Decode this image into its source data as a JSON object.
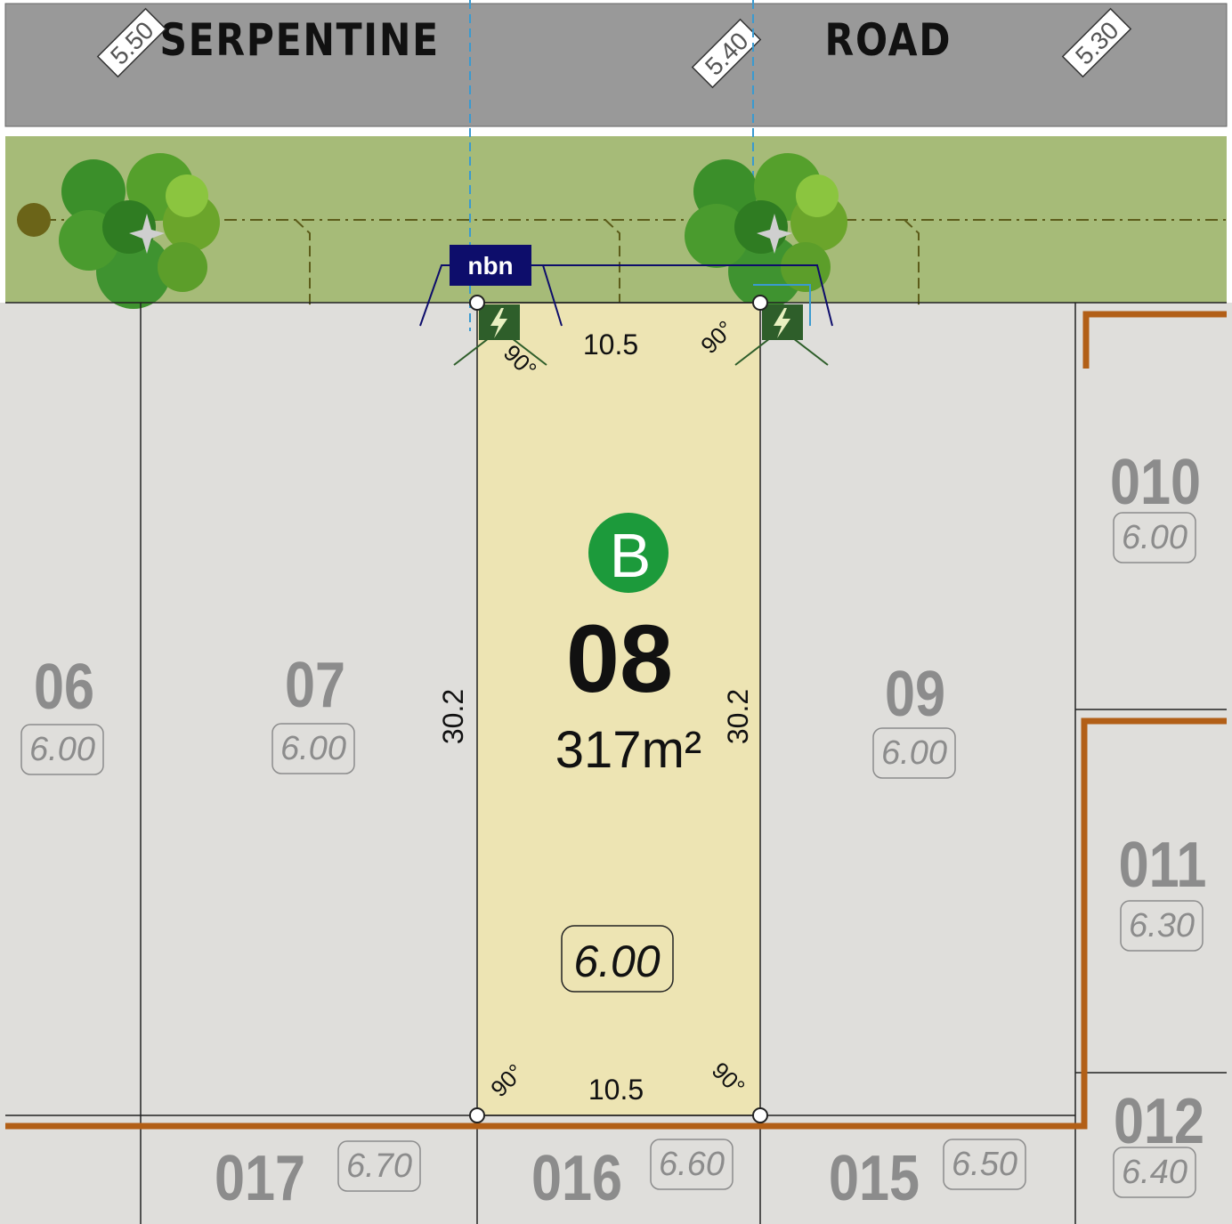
{
  "road": {
    "name_left": "SERPENTINE",
    "name_right": "ROAD",
    "levels": [
      "5.50",
      "5.40",
      "5.30"
    ]
  },
  "nbn_label": "nbn",
  "selected_lot": {
    "number": "08",
    "area": "317m²",
    "badge": "B",
    "level": "6.00",
    "frontage": "10.5",
    "rear": "10.5",
    "side_left": "30.2",
    "side_right": "30.2",
    "angle": "90°"
  },
  "lots": [
    {
      "id": "06",
      "level": "6.00"
    },
    {
      "id": "07",
      "level": "6.00"
    },
    {
      "id": "09",
      "level": "6.00"
    },
    {
      "id": "010",
      "level": "6.00"
    },
    {
      "id": "011",
      "level": "6.30"
    },
    {
      "id": "012",
      "level": "6.40"
    },
    {
      "id": "015",
      "level": "6.50"
    },
    {
      "id": "016",
      "level": "6.60"
    },
    {
      "id": "017",
      "level": "6.70"
    }
  ],
  "colors": {
    "road": "#999999",
    "verge": "#a6bb78",
    "lot": "#dfdedb",
    "selected_lot": "#ede4b3",
    "retaining_wall": "#b25f17",
    "nbn": "#0d0d6b",
    "power_pit": "#2e5e2a",
    "badge": "#1c9a3b",
    "service_line": "#3a9ad0"
  }
}
